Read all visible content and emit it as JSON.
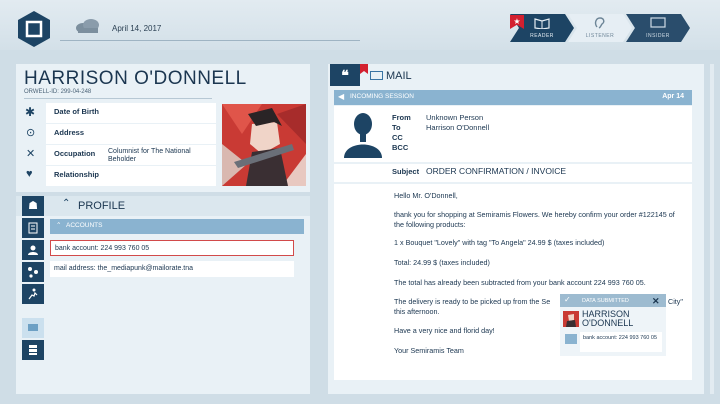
{
  "header": {
    "date": "April 14, 2017",
    "tabs": [
      {
        "label": "READER",
        "active": true
      },
      {
        "label": "LISTENER",
        "active": false
      },
      {
        "label": "INSIDER",
        "active": false
      }
    ]
  },
  "profile": {
    "name": "HARRISON O'DONNELL",
    "orwell_id": "ORWELL-ID: 299-04-248",
    "fields": [
      {
        "label": "Date of Birth",
        "value": ""
      },
      {
        "label": "Address",
        "value": ""
      },
      {
        "label": "Occupation",
        "value": "Columnist for The National Beholder"
      },
      {
        "label": "Relationship",
        "value": ""
      }
    ],
    "section_title": "PROFILE",
    "accounts_title": "ACCOUNTS",
    "accounts": [
      "bank account: 224 993 760 05",
      "mail address: the_mediapunk@mailorate.tna"
    ]
  },
  "mail": {
    "title": "MAIL",
    "session_label": "INCOMING SESSION",
    "session_date": "Apr 14",
    "header": {
      "from_label": "From",
      "from": "Unknown Person",
      "to_label": "To",
      "to": "Harrison O'Donnell",
      "cc_label": "CC",
      "cc": "",
      "bcc_label": "BCC",
      "bcc": ""
    },
    "subject_label": "Subject",
    "subject": "ORDER CONFIRMATION / INVOICE",
    "body": {
      "greeting": "Hello Mr. O'Donnell,",
      "p1": "thank you for shopping at Semiramis Flowers. We hereby confirm your order #122145 of the following products:",
      "p2": "1 x Bouquet \"Lovely\" with tag \"To Angela\" 24.99 $ (taxes included)",
      "p3": "Total: 24.99 $ (taxes included)",
      "p4": "The total has already been subtracted from your bank account 224 993 760 05.",
      "p5a": "The delivery is ready to be picked up from the Se",
      "p5b": "City\"",
      "p5c": "this afternoon.",
      "p6": "Have a very nice and florid day!",
      "p7": "Your Semiramis Team"
    }
  },
  "popup": {
    "title": "DATA SUBMITTED",
    "close": "✕",
    "name": "HARRISON O'DONNELL",
    "value": "bank account: 224 993 760 05"
  },
  "colors": {
    "accent": "#1d4464",
    "highlight": "#d24a4a",
    "bar": "#8ab3d0"
  }
}
